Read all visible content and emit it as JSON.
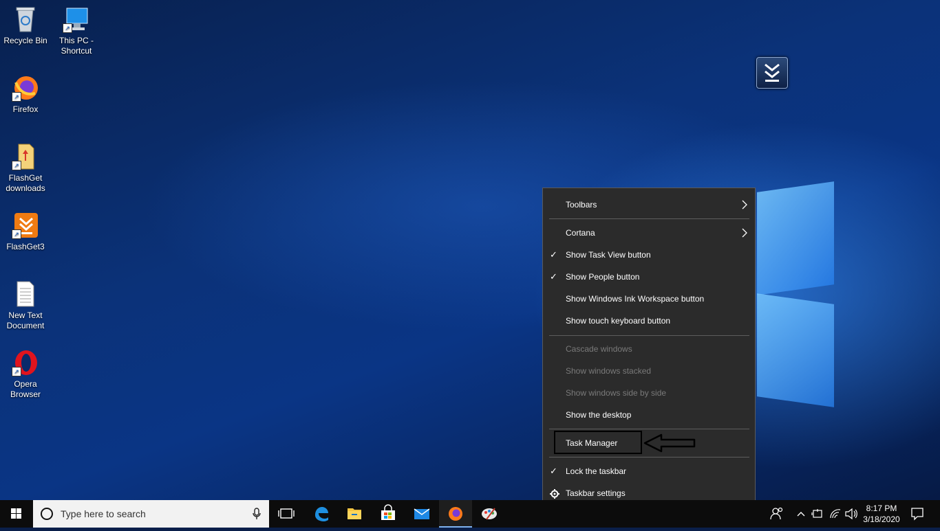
{
  "desktop": {
    "icons": [
      {
        "label_line1": "Recycle Bin",
        "label_line2": ""
      },
      {
        "label_line1": "This PC -",
        "label_line2": "Shortcut"
      },
      {
        "label_line1": "Firefox",
        "label_line2": ""
      },
      {
        "label_line1": "FlashGet",
        "label_line2": "downloads"
      },
      {
        "label_line1": "FlashGet3",
        "label_line2": ""
      },
      {
        "label_line1": "New Text",
        "label_line2": "Document"
      },
      {
        "label_line1": "Opera",
        "label_line2": "Browser"
      }
    ]
  },
  "context_menu": {
    "items": [
      {
        "label": "Toolbars",
        "checked": false,
        "disabled": false,
        "submenu": true
      },
      {
        "label": "Cortana",
        "checked": false,
        "disabled": false,
        "submenu": true
      },
      {
        "label": "Show Task View button",
        "checked": true,
        "disabled": false
      },
      {
        "label": "Show People button",
        "checked": true,
        "disabled": false
      },
      {
        "label": "Show Windows Ink Workspace button",
        "checked": false,
        "disabled": false
      },
      {
        "label": "Show touch keyboard button",
        "checked": false,
        "disabled": false
      },
      {
        "label": "Cascade windows",
        "checked": false,
        "disabled": true
      },
      {
        "label": "Show windows stacked",
        "checked": false,
        "disabled": true
      },
      {
        "label": "Show windows side by side",
        "checked": false,
        "disabled": true
      },
      {
        "label": "Show the desktop",
        "checked": false,
        "disabled": false
      },
      {
        "label": "Task Manager",
        "checked": false,
        "disabled": false
      },
      {
        "label": "Lock the taskbar",
        "checked": true,
        "disabled": false
      },
      {
        "label": "Taskbar settings",
        "checked": false,
        "disabled": false
      }
    ],
    "check_glyph": "✓",
    "chevron_glyph": "›"
  },
  "taskbar": {
    "search_placeholder": "Type here to search",
    "pinned_apps": [
      "task-view",
      "edge",
      "file-explorer",
      "microsoft-store",
      "mail",
      "firefox",
      "paint"
    ],
    "clock": {
      "time": "8:17 PM",
      "date": "3/18/2020"
    }
  },
  "colors": {
    "menu_bg": "#2b2b2b",
    "taskbar_bg": "#0c0c0c",
    "accent": "#0078d7"
  }
}
